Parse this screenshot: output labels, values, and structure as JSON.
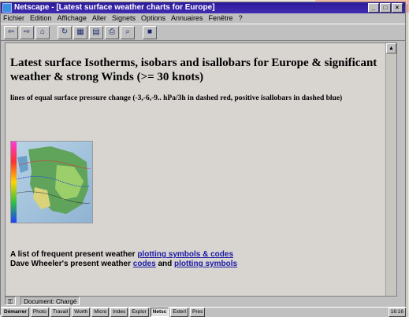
{
  "window": {
    "title": "Netscape - [Latest surface weather charts for Europe]",
    "controls": [
      "_",
      "□",
      "×"
    ]
  },
  "menu": [
    "Fichier",
    "Edition",
    "Affichage",
    "Aller",
    "Signets",
    "Options",
    "Annuaires",
    "Fenêtre",
    "?"
  ],
  "toolbar": {
    "buttons": [
      "back-icon",
      "forward-icon",
      "home-icon",
      "reload-icon",
      "images-icon",
      "open-icon",
      "print-icon",
      "find-icon",
      "stop-icon"
    ]
  },
  "page": {
    "heading": "Latest surface Isotherms, isobars and isallobars for Europe & significant weather & strong Winds (>= 30 knots)",
    "subnote": "lines of equal surface pressure change (-3,-6,-9.. hPa/3h in dashed red, positive isallobars in dashed blue)",
    "link_line1_prefix": "A list of frequent present weather ",
    "link_line1_link": "plotting symbols & codes",
    "link_line2_prefix": "Dave Wheeler's present weather ",
    "link_line2_link1": "codes",
    "link_line2_and": " and ",
    "link_line2_link2": "plotting symbols"
  },
  "status": {
    "icon": "lock-icon",
    "text": "Document: Chargé"
  },
  "taskbar": {
    "start": "Démarrer",
    "items": [
      "Photo",
      "Travail",
      "Worth",
      "Micro",
      "Indes",
      "Explor",
      "Netsc",
      "Exterl",
      "Pres"
    ],
    "clock": "16:16"
  },
  "colors": {
    "titlebar": "#2d1a9a",
    "link": "#1a1aa6",
    "content_bg": "#d8d4d0"
  }
}
